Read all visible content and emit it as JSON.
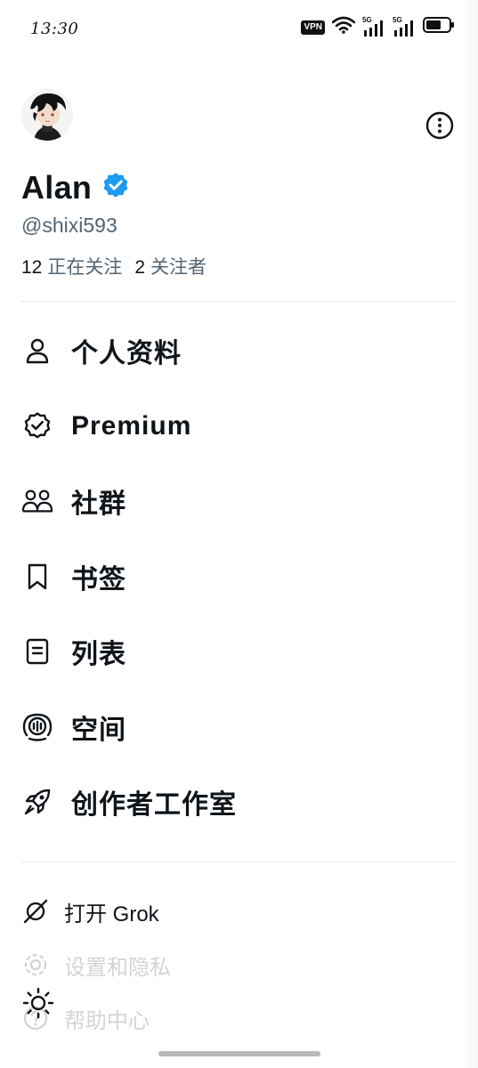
{
  "status_bar": {
    "time": "13:30",
    "vpn_label": "VPN",
    "signal1_label": "5G",
    "signal2_label": "5G",
    "icons": [
      "vpn-badge",
      "wifi-icon",
      "signal-5g-icon",
      "signal-5g-icon",
      "battery-icon"
    ]
  },
  "profile": {
    "display_name": "Alan",
    "verified": true,
    "handle": "@shixi593",
    "following_count": "12",
    "following_label": "正在关注",
    "followers_count": "2",
    "followers_label": "关注者"
  },
  "menu": {
    "items": [
      {
        "label": "个人资料",
        "icon": "person-icon"
      },
      {
        "label": "Premium",
        "icon": "verified-badge-icon"
      },
      {
        "label": "社群",
        "icon": "communities-icon"
      },
      {
        "label": "书签",
        "icon": "bookmark-icon"
      },
      {
        "label": "列表",
        "icon": "list-icon"
      },
      {
        "label": "空间",
        "icon": "spaces-icon"
      },
      {
        "label": "创作者工作室",
        "icon": "rocket-icon"
      }
    ]
  },
  "secondary": {
    "items": [
      {
        "label": "打开 Grok",
        "icon": "grok-icon"
      },
      {
        "label": "设置和隐私",
        "icon": "gear-icon"
      },
      {
        "label": "帮助中心",
        "icon": "help-icon"
      }
    ]
  },
  "colors": {
    "text_primary": "#0f1419",
    "text_secondary": "#536471",
    "verified_blue": "#1d9bf0",
    "divider": "#e7e9ea"
  }
}
